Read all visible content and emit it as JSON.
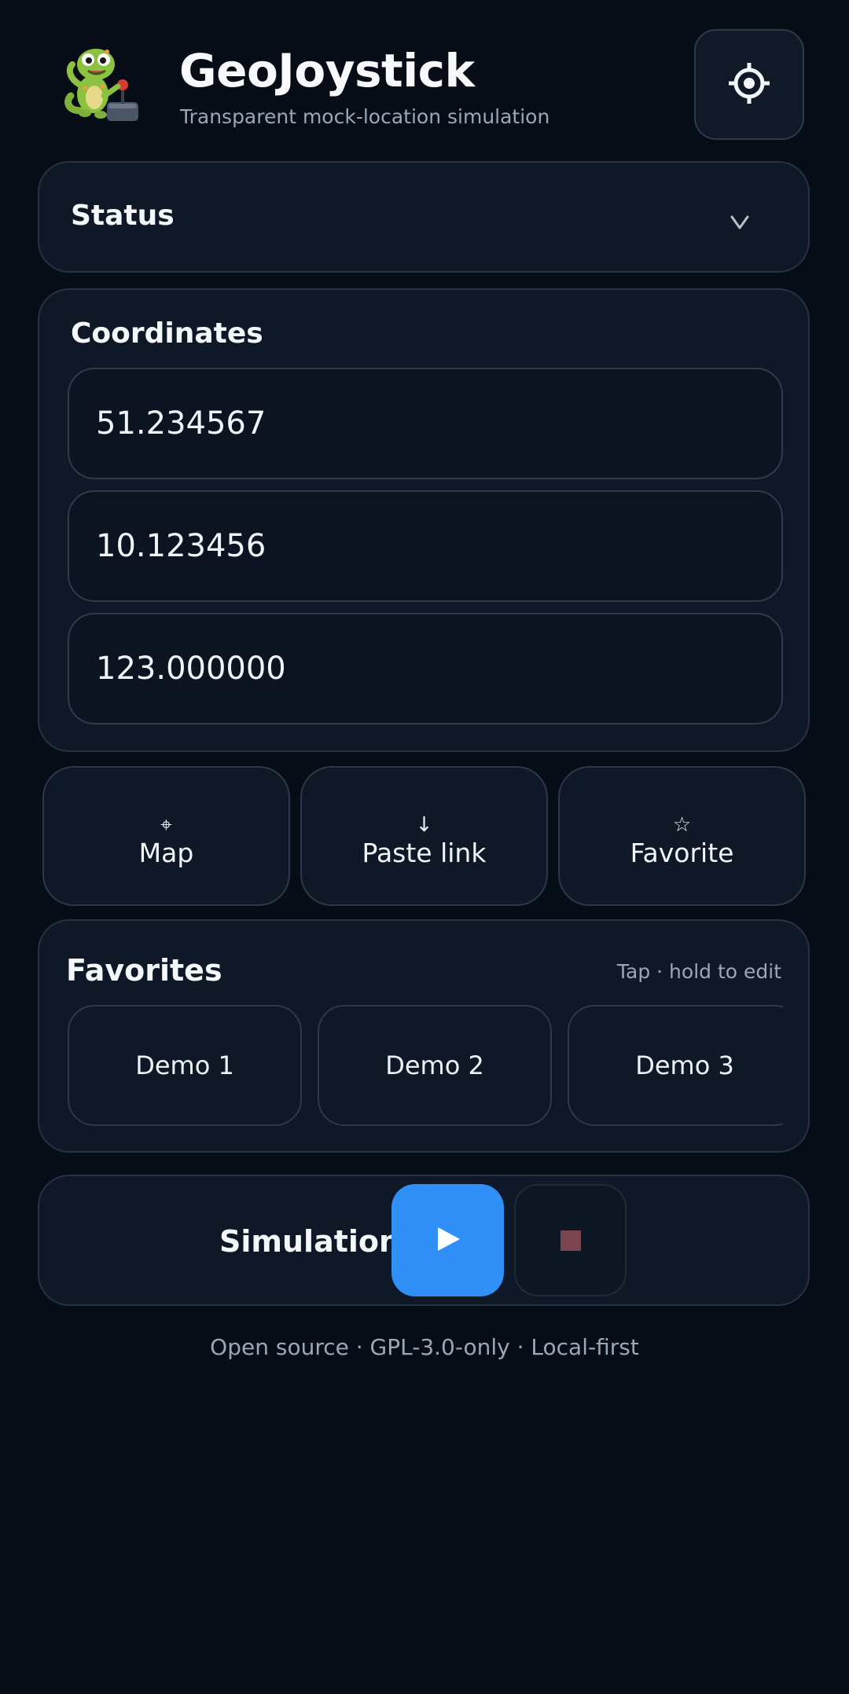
{
  "header": {
    "title": "GeoJoystick",
    "subtitle": "Transparent mock-location simulation",
    "logo_icon": "gecko-joystick-mascot-icon",
    "settings_icon": "gear-icon"
  },
  "status": {
    "title": "Status",
    "chevron_icon": "chevron-down-icon",
    "expanded": false
  },
  "coordinates": {
    "title": "Coordinates",
    "latitude": "51.234567",
    "longitude": "10.123456",
    "altitude": "123.000000"
  },
  "actions": [
    {
      "icon": "⌖",
      "icon_name": "crosshair-icon",
      "label": "Map"
    },
    {
      "icon": "↓",
      "icon_name": "arrow-down-icon",
      "label": "Paste link"
    },
    {
      "icon": "☆",
      "icon_name": "star-icon",
      "label": "Favorite"
    }
  ],
  "favorites": {
    "title": "Favorites",
    "hint": "Tap · hold to edit",
    "items": [
      {
        "label": "Demo 1"
      },
      {
        "label": "Demo 2"
      },
      {
        "label": "Demo 3"
      }
    ]
  },
  "simulation": {
    "title": "Simulation",
    "play_icon": "play-icon",
    "stop_icon": "stop-icon",
    "running": false
  },
  "footer": {
    "text": "Open source · GPL-3.0-only · Local-first"
  },
  "colors": {
    "background": "#070d16",
    "card": "#0e1827",
    "accent": "#3090f8",
    "muted_text": "#9aa7b8",
    "stop": "#7a4450"
  }
}
